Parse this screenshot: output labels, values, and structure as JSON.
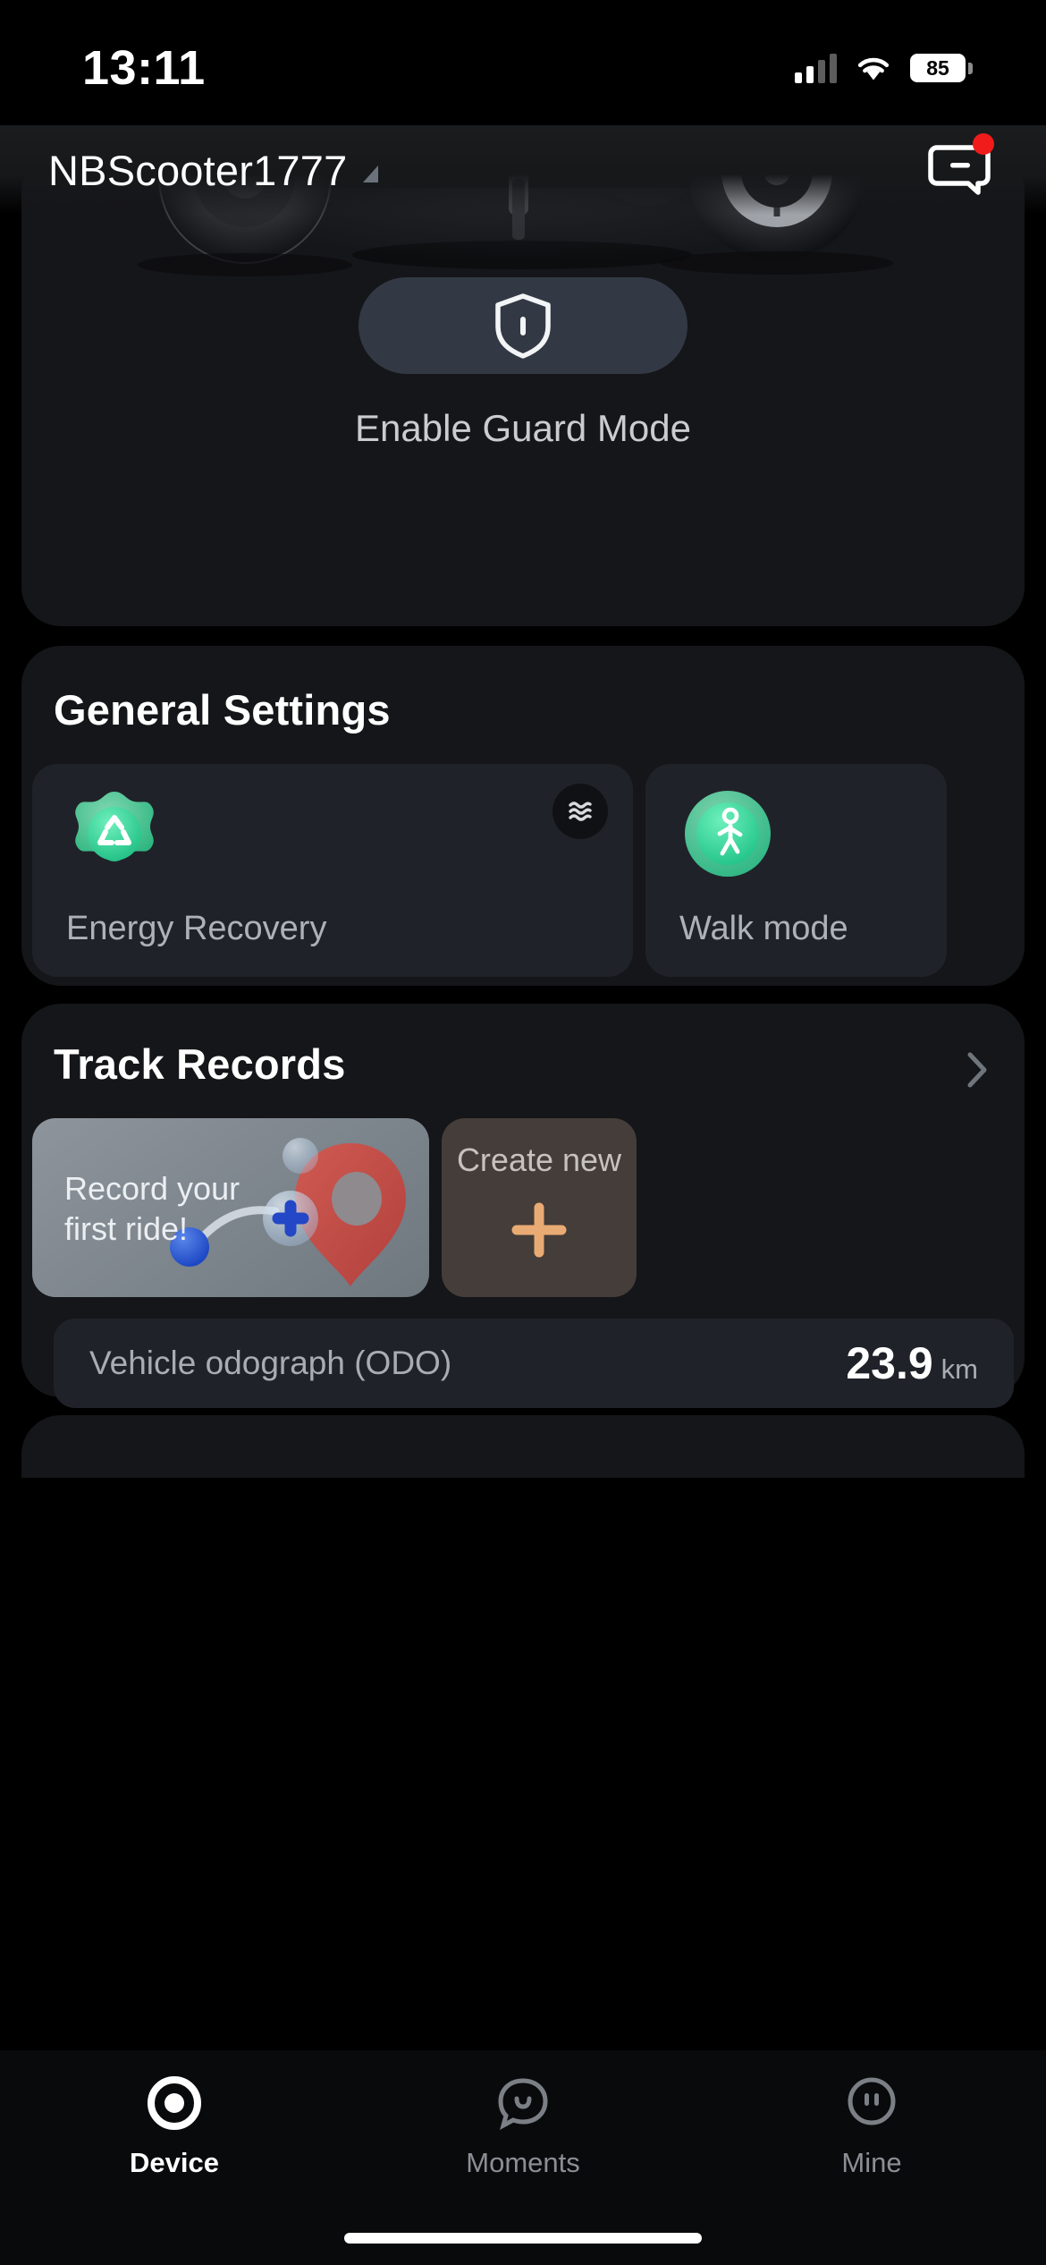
{
  "status_bar": {
    "time": "13:11",
    "battery_percent": "85",
    "signal_icon": "cellular-signal-icon",
    "wifi_icon": "wifi-icon",
    "battery_icon": "battery-icon"
  },
  "header": {
    "device_name": "NBScooter1777",
    "dropdown_icon": "caret-down-icon",
    "message_icon": "message-bubble-icon",
    "has_notification": true,
    "notification_dot_color": "#f21b1b"
  },
  "hero": {
    "vehicle_image": "scooter-wheels-image",
    "guard_icon": "shield-icon",
    "guard_label": "Enable Guard Mode"
  },
  "general_settings": {
    "title": "General Settings",
    "cards": [
      {
        "label": "Energy Recovery",
        "icon": "recycle-energy-icon",
        "badge_icon": "wave-level-icon",
        "accent": "#3ddc97"
      },
      {
        "label": "Walk mode",
        "icon": "walking-person-icon",
        "accent": "#3ddc97"
      }
    ]
  },
  "track_records": {
    "title": "Track Records",
    "chevron_icon": "chevron-right-icon",
    "map_card": {
      "hint_line1": "Record your",
      "hint_line2": "first ride!",
      "illustration": "map-pin-illustration"
    },
    "create_card": {
      "label": "Create new",
      "icon": "plus-icon",
      "icon_color": "#e9ab74"
    },
    "odograph": {
      "label": "Vehicle odograph (ODO)",
      "value": "23.9",
      "unit": "km"
    }
  },
  "tab_bar": {
    "items": [
      {
        "label": "Device",
        "icon": "device-circle-icon",
        "active": true
      },
      {
        "label": "Moments",
        "icon": "moments-smiley-icon",
        "active": false
      },
      {
        "label": "Mine",
        "icon": "mine-face-icon",
        "active": false
      }
    ]
  }
}
